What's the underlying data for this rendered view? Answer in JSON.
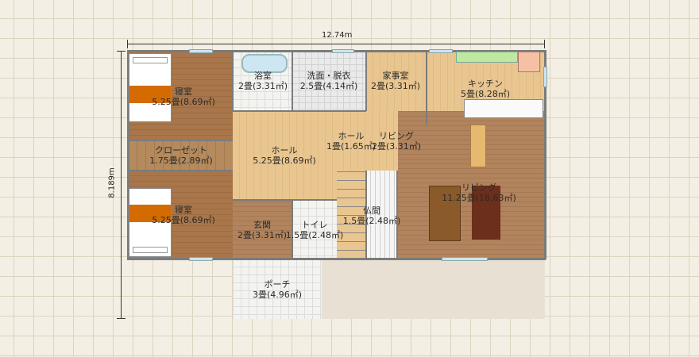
{
  "dimensions": {
    "width": "12.74m",
    "height": "8.189m"
  },
  "rooms": {
    "bedroom1": {
      "name": "寝室",
      "area": "5.25畳(8.69㎡)"
    },
    "bath": {
      "name": "浴室",
      "area": "2畳(3.31㎡)"
    },
    "washroom": {
      "name": "洗面・脱衣",
      "area": "2.5畳(4.14㎡)"
    },
    "utility": {
      "name": "家事室",
      "area": "2畳(3.31㎡)"
    },
    "kitchen": {
      "name": "キッチン",
      "area": "5畳(8.28㎡)"
    },
    "closet": {
      "name": "クローゼット",
      "area": "1.75畳(2.89㎡)"
    },
    "hall": {
      "name": "ホール",
      "area": "5.25畳(8.69㎡)"
    },
    "hall_small": {
      "name": "ホール",
      "area": "1畳(1.65㎡)"
    },
    "living_small": {
      "name": "リビング",
      "area": "2畳(3.31㎡)"
    },
    "bedroom2": {
      "name": "寝室",
      "area": "5.25畳(8.69㎡)"
    },
    "entrance": {
      "name": "玄関",
      "area": "2畳(3.31㎡)"
    },
    "toilet": {
      "name": "トイレ",
      "area": "1.5畳(2.48㎡)"
    },
    "altar_room": {
      "name": "仏間",
      "area": "1.5畳(2.48㎡)"
    },
    "living": {
      "name": "リビング",
      "area": "11.25畳(18.63㎡)"
    },
    "porch": {
      "name": "ポーチ",
      "area": "3畳(4.96㎡)"
    }
  },
  "colors": {
    "wall": "#7b7b7b",
    "blanket": "#d46b00",
    "grid": "#dcd3c0",
    "background": "#f4efe4"
  }
}
